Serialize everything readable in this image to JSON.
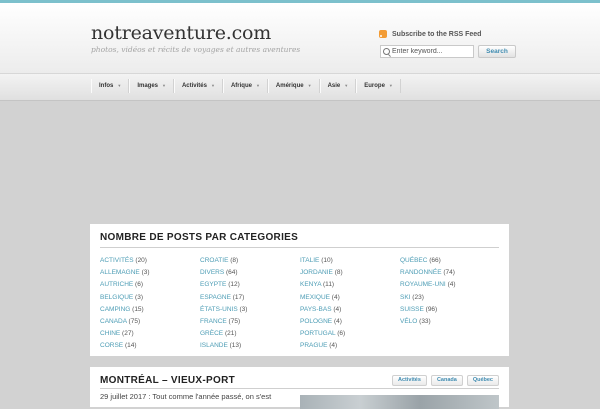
{
  "site": {
    "title": "notreaventure.com",
    "tagline": "photos, vidéos et récits de voyages et autres aventures"
  },
  "rss": {
    "label": "Subscribe to the RSS Feed",
    "icon": "rss-icon"
  },
  "search": {
    "placeholder": "Enter keyword...",
    "button_label": "Search",
    "icon": "search-icon"
  },
  "nav": [
    "Infos",
    "Images",
    "Activités",
    "Afrique",
    "Amérique",
    "Asie",
    "Europe"
  ],
  "categories": {
    "title": "NOMBRE DE POSTS PAR CATEGORIES",
    "columns": [
      [
        {
          "name": "ACTIVITÉS",
          "count": "(20)"
        },
        {
          "name": "ALLEMAGNE",
          "count": "(3)"
        },
        {
          "name": "AUTRICHE",
          "count": "(6)"
        },
        {
          "name": "BELGIQUE",
          "count": "(3)"
        },
        {
          "name": "CAMPING",
          "count": "(15)"
        },
        {
          "name": "CANADA",
          "count": "(75)"
        },
        {
          "name": "CHINE",
          "count": "(27)"
        },
        {
          "name": "CORSE",
          "count": "(14)"
        }
      ],
      [
        {
          "name": "CROATIE",
          "count": "(8)"
        },
        {
          "name": "DIVERS",
          "count": "(64)"
        },
        {
          "name": "EGYPTE",
          "count": "(12)"
        },
        {
          "name": "ESPAGNE",
          "count": "(17)"
        },
        {
          "name": "ÉTATS-UNIS",
          "count": "(3)"
        },
        {
          "name": "FRANCE",
          "count": "(75)"
        },
        {
          "name": "GRÈCE",
          "count": "(21)"
        },
        {
          "name": "ISLANDE",
          "count": "(13)"
        }
      ],
      [
        {
          "name": "ITALIE",
          "count": "(10)"
        },
        {
          "name": "JORDANIE",
          "count": "(8)"
        },
        {
          "name": "KENYA",
          "count": "(11)"
        },
        {
          "name": "MEXIQUE",
          "count": "(4)"
        },
        {
          "name": "PAYS-BAS",
          "count": "(4)"
        },
        {
          "name": "POLOGNE",
          "count": "(4)"
        },
        {
          "name": "PORTUGAL",
          "count": "(6)"
        },
        {
          "name": "PRAGUE",
          "count": "(4)"
        }
      ],
      [
        {
          "name": "QUÉBEC",
          "count": "(66)"
        },
        {
          "name": "RANDONNÉE",
          "count": "(74)"
        },
        {
          "name": "ROYAUME-UNI",
          "count": "(4)"
        },
        {
          "name": "SKI",
          "count": "(23)"
        },
        {
          "name": "SUISSE",
          "count": "(96)"
        },
        {
          "name": "VÉLO",
          "count": "(33)"
        }
      ]
    ]
  },
  "post": {
    "title": "MONTRÉAL – VIEUX-PORT",
    "tags": [
      "Activités",
      "Canada",
      "Québec"
    ],
    "excerpt": "29 juillet 2017 : Tout comme l'année passé, on s'est"
  },
  "colors": {
    "accent": "#4d9db5",
    "topbar": "#7cc0cc",
    "rss": "#f39c35"
  }
}
